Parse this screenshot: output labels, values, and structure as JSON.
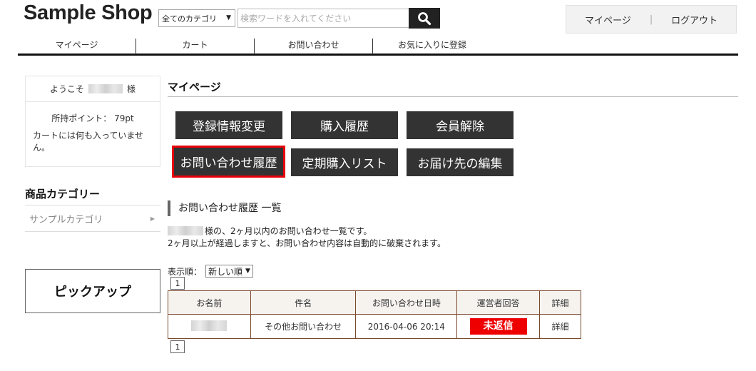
{
  "header": {
    "logo": "Sample Shop",
    "category_select": "全てのカテゴリ",
    "search_placeholder": "検索ワードを入れてください",
    "mypage_link": "マイページ",
    "separator": "|",
    "logout_link": "ログアウト"
  },
  "gnav": {
    "items": [
      "マイページ",
      "カート",
      "お問い合わせ",
      "お気に入りに登録"
    ]
  },
  "sidebar": {
    "welcome_prefix": "ようこそ",
    "welcome_suffix": "様",
    "points": "所持ポイント： 79pt",
    "cart_empty": "カートには何も入っていません。",
    "category_heading": "商品カテゴリー",
    "category_item": "サンプルカテゴリ",
    "pickup": "ピックアップ"
  },
  "main": {
    "title": "マイページ",
    "buttons": [
      "登録情報変更",
      "購入履歴",
      "会員解除",
      "お問い合わせ履歴",
      "定期購入リスト",
      "お届け先の編集"
    ],
    "section_title": "お問い合わせ履歴 一覧",
    "desc_line1": "様の、2ヶ月以内のお問い合わせ一覧です。",
    "desc_line2": "2ヶ月以上が経過しますと、お問い合わせ内容は自動的に破棄されます。",
    "sort_label": "表示順：",
    "sort_value": "新しい順",
    "pager_top": "1",
    "pager_bottom": "1",
    "table": {
      "headers": [
        "お名前",
        "件名",
        "お問い合わせ日時",
        "運営者回答",
        "詳細"
      ],
      "rows": [
        {
          "subject": "その他お問い合わせ",
          "datetime": "2016-04-06 20:14",
          "status": "未返信",
          "detail": "詳細"
        }
      ]
    }
  },
  "colors": {
    "button_bg": "#333333",
    "active_outline": "#e8000b",
    "badge_red": "#ee0000",
    "table_border": "#7a4a2e"
  }
}
